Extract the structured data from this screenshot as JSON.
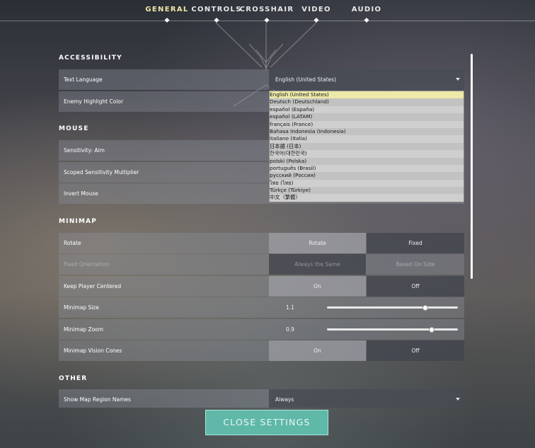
{
  "tabs": [
    {
      "label": "GENERAL"
    },
    {
      "label": "CONTROLS"
    },
    {
      "label": "CROSSHAIR"
    },
    {
      "label": "VIDEO"
    },
    {
      "label": "AUDIO"
    }
  ],
  "sections": {
    "accessibility": "ACCESSIBILITY",
    "mouse": "MOUSE",
    "minimap": "MINIMAP",
    "other": "OTHER"
  },
  "accessibility": {
    "text_language": {
      "label": "Text Language",
      "value": "English (United States)"
    },
    "enemy_highlight": {
      "label": "Enemy Highlight Color"
    }
  },
  "mouse": {
    "sensitivity_aim": {
      "label": "Sensitivity: Aim"
    },
    "scoped_sensitivity": {
      "label": "Scoped Sensitivity Multiplier"
    },
    "invert_mouse": {
      "label": "Invert Mouse"
    }
  },
  "minimap": {
    "rotate": {
      "label": "Rotate",
      "opt1": "Rotate",
      "opt2": "Fixed"
    },
    "fixed_orientation": {
      "label": "Fixed Orientation",
      "opt1": "Always the Same",
      "opt2": "Based On Side"
    },
    "keep_centered": {
      "label": "Keep Player Centered",
      "opt1": "On",
      "opt2": "Off"
    },
    "size": {
      "label": "Minimap Size",
      "value": "1.1",
      "level": 0.75
    },
    "zoom": {
      "label": "Minimap Zoom",
      "value": "0.9",
      "level": 0.8
    },
    "vision_cones": {
      "label": "Minimap Vision Cones",
      "opt1": "On",
      "opt2": "Off"
    }
  },
  "other": {
    "region_names": {
      "label": "Show Map Region Names",
      "value": "Always"
    }
  },
  "language_dropdown": [
    "English (United States)",
    "Deutsch (Deutschland)",
    "español (España)",
    "español (LATAM)",
    "français (France)",
    "Bahasa Indonesia (Indonesia)",
    "italiano (Italia)",
    "日本語 (日本)",
    "한국어(대한민국)",
    "polski (Polska)",
    "português (Brasil)",
    "русский (Россия)",
    "ไทย (ไทย)",
    "Türkçe (Türkiye)",
    "中文（繁體）"
  ],
  "close_button": "CLOSE SETTINGS",
  "colors": {
    "active_tab": "#efe6a8",
    "dropdown_highlight": "#ece9a9",
    "close_button": "#5fb8a8"
  }
}
